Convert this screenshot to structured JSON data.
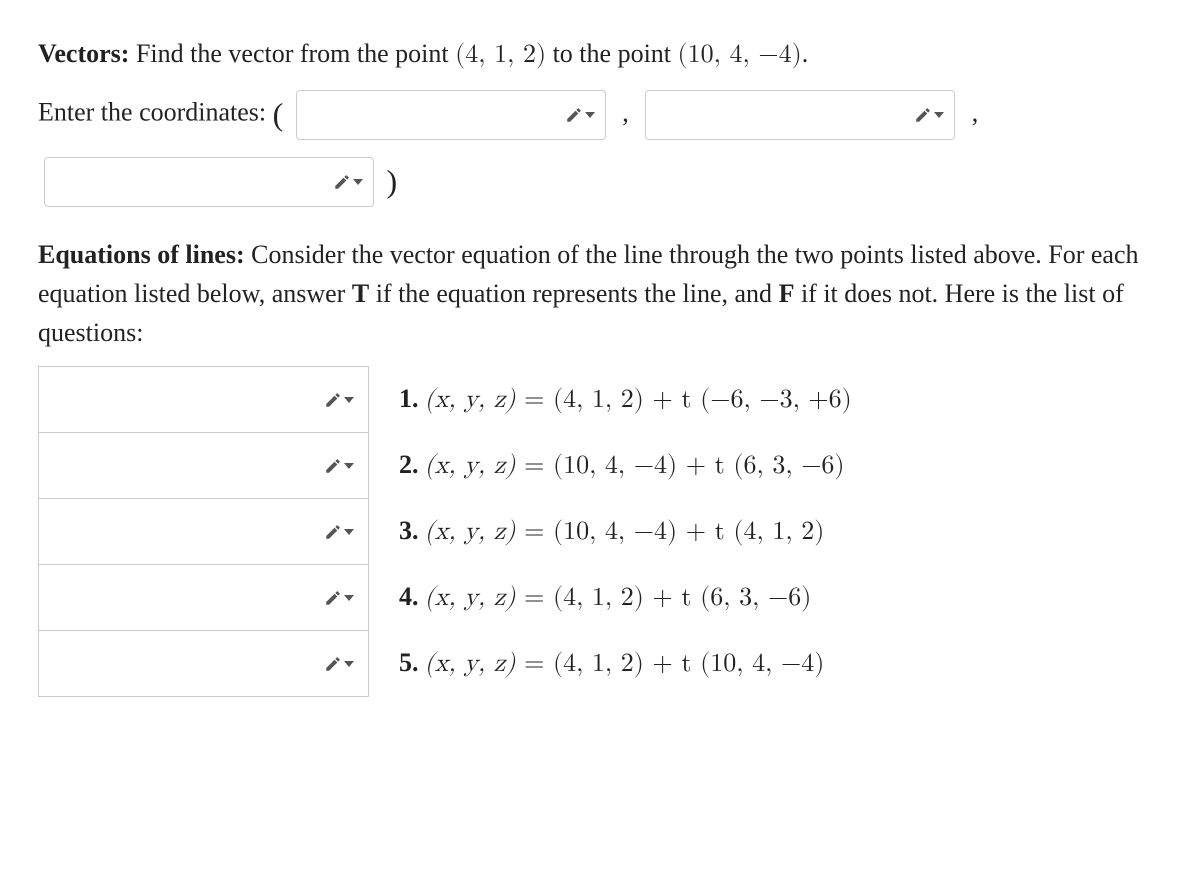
{
  "vectors": {
    "heading": "Vectors:",
    "prompt_part1": " Find the vector from the point ",
    "point1": "(4, 1, 2)",
    "prompt_part2": " to the point ",
    "point2": "(10, 4, −4)",
    "prompt_end": ".",
    "enter_label": "Enter the coordinates: ",
    "open_paren": "(",
    "comma": ",",
    "close_paren": ")"
  },
  "equations": {
    "heading": "Equations of lines:",
    "text_part1": " Consider the vector equation of the line through the two points listed above. For each equation listed below, answer ",
    "t_label": "T",
    "text_part2": " if the equation represents the line, and ",
    "f_label": "F",
    "text_part3": " if it does not. Here is the list of questions:"
  },
  "items": [
    {
      "num": "1.",
      "lhs": "(x, y, z)",
      "eq": " = ",
      "rhs": "(4, 1, 2) + t (−6, −3, +6)"
    },
    {
      "num": "2.",
      "lhs": "(x, y, z)",
      "eq": " = ",
      "rhs": "(10, 4, −4) + t (6, 3, −6)"
    },
    {
      "num": "3.",
      "lhs": "(x, y, z)",
      "eq": " = ",
      "rhs": "(10, 4, −4) + t (4, 1, 2)"
    },
    {
      "num": "4.",
      "lhs": "(x, y, z)",
      "eq": " = ",
      "rhs": "(4, 1, 2) + t (6, 3, −6)"
    },
    {
      "num": "5.",
      "lhs": "(x, y, z)",
      "eq": " = ",
      "rhs": "(4, 1, 2) + t (10, 4, −4)"
    }
  ]
}
